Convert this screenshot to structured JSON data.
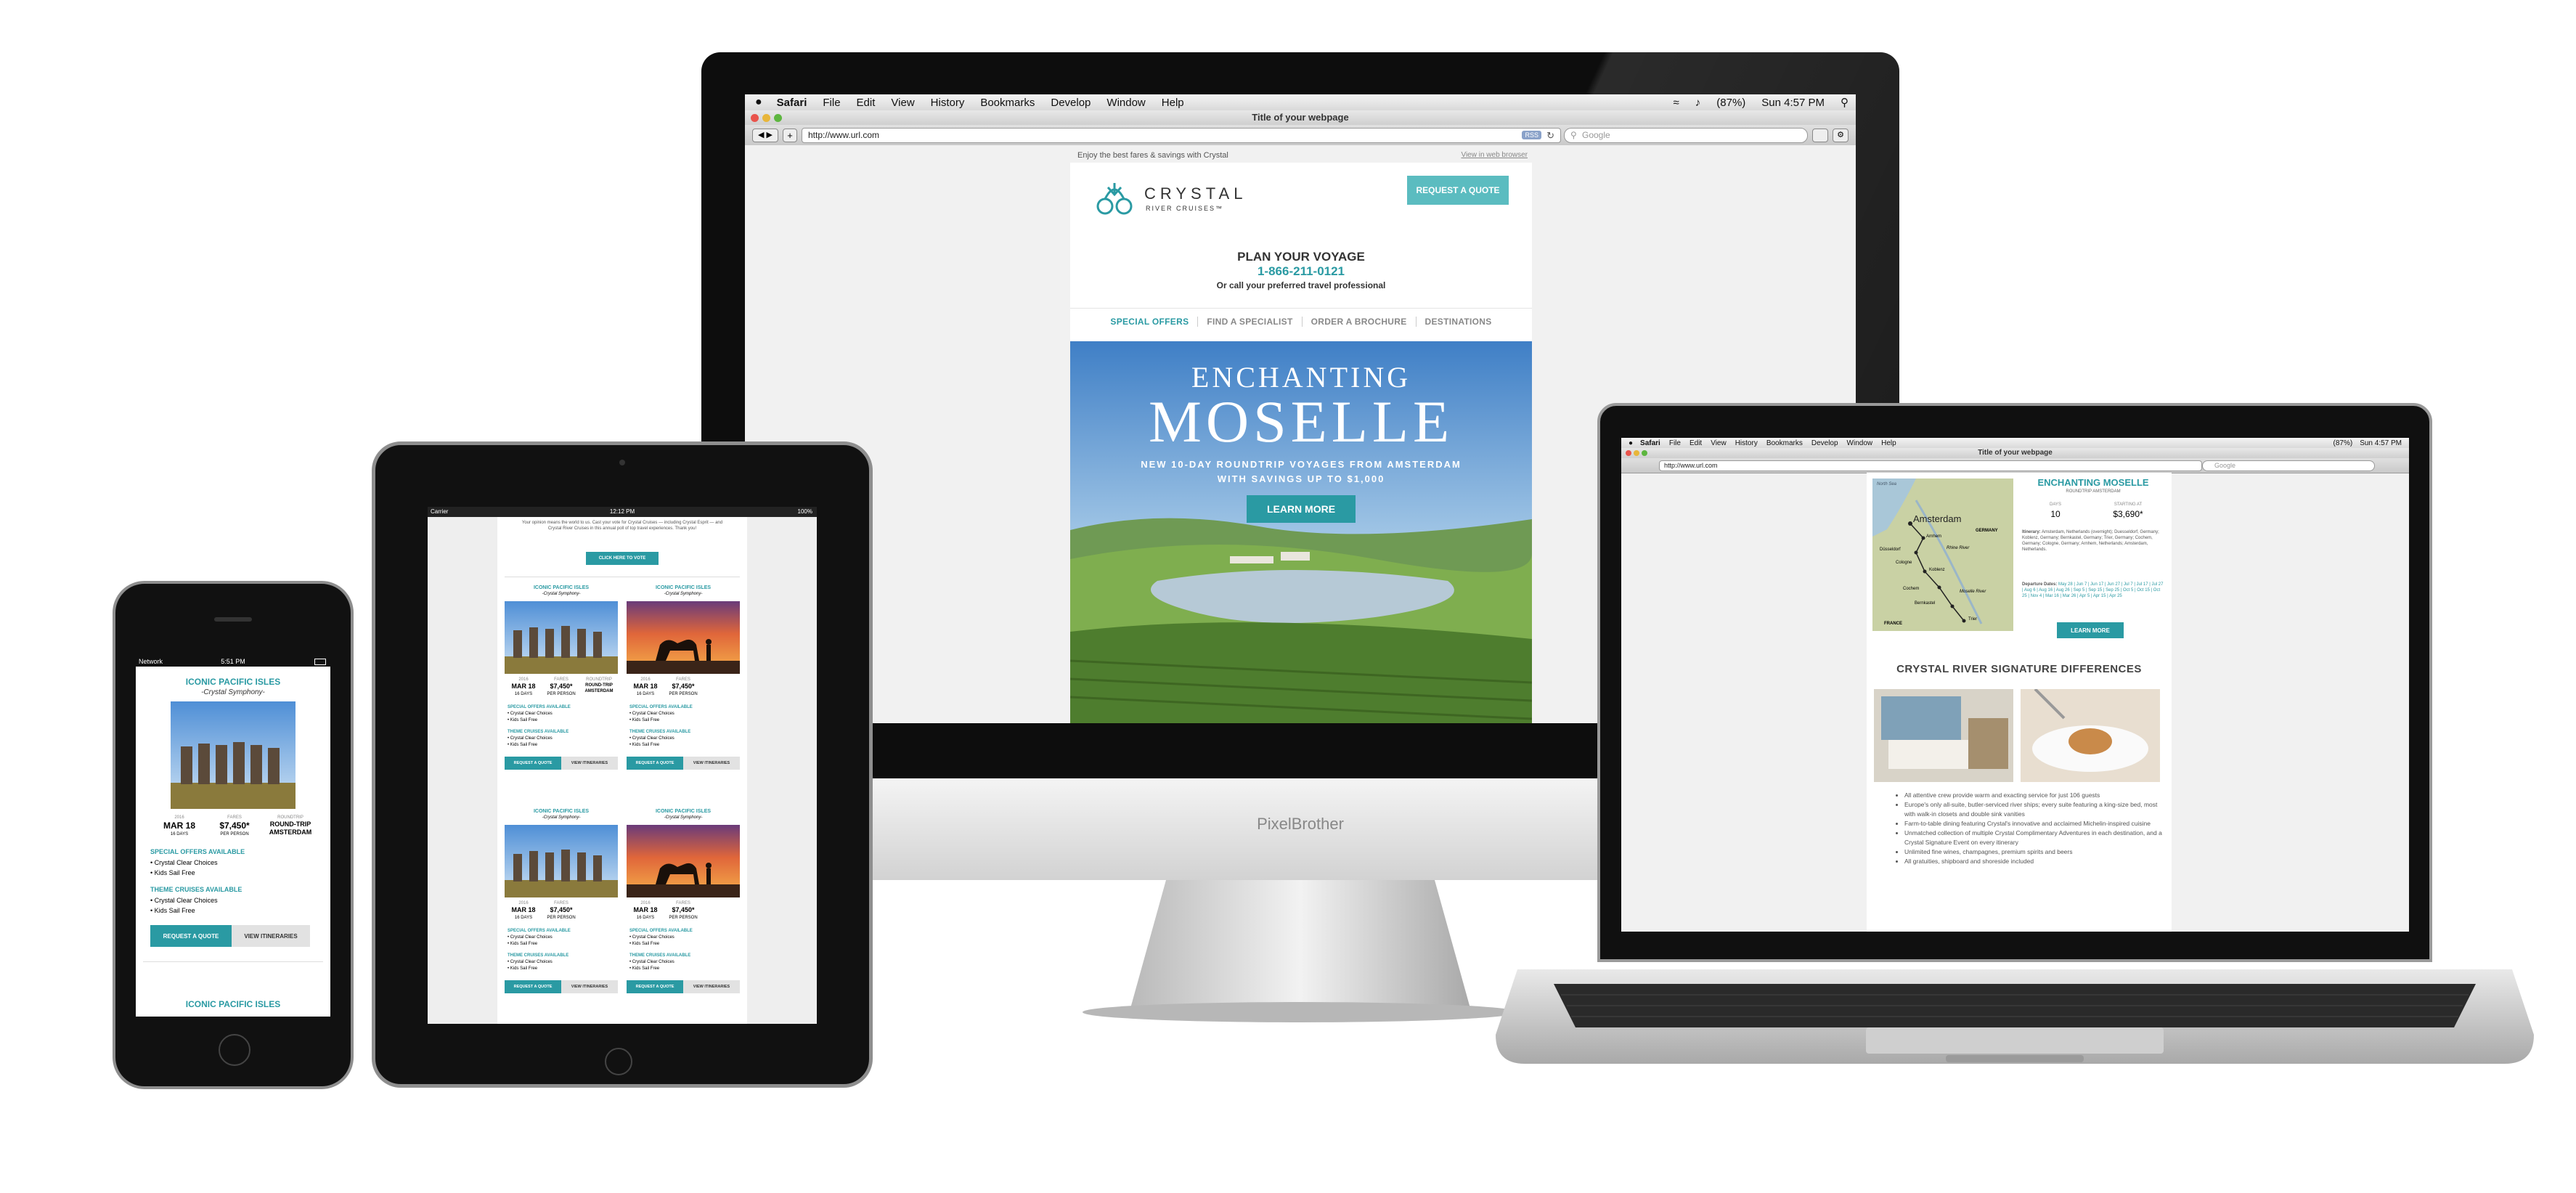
{
  "monitor": {
    "brand": "PixelBrother",
    "menubar": {
      "apple": "",
      "items": [
        "Safari",
        "File",
        "Edit",
        "View",
        "History",
        "Bookmarks",
        "Develop",
        "Window",
        "Help"
      ],
      "battery": "(87%)",
      "clock": "Sun 4:57 PM"
    },
    "window_title": "Title of your webpage",
    "url": "http://www.url.com",
    "search_placeholder": "Google",
    "rss": "RSS"
  },
  "email": {
    "preheader": "Enjoy the best fares & savings with Crystal",
    "view_in_browser": "View in web browser",
    "logo_name": "CRYSTAL",
    "logo_sub": "RIVER CRUISES™",
    "request_quote": "REQUEST A QUOTE",
    "plan_title": "PLAN YOUR VOYAGE",
    "phone": "1-866-211-0121",
    "plan_sub": "Or call your preferred travel professional",
    "nav": [
      "SPECIAL OFFERS",
      "FIND A SPECIALIST",
      "ORDER A BROCHURE",
      "DESTINATIONS"
    ],
    "hero_line1": "ENCHANTING",
    "hero_line2": "MOSELLE",
    "hero_tag1": "NEW 10-DAY ROUNDTRIP VOYAGES FROM AMSTERDAM",
    "hero_tag2": "WITH SAVINGS UP TO $1,000",
    "learn_more": "LEARN MORE"
  },
  "laptop": {
    "menubar": {
      "items": [
        "Safari",
        "File",
        "Edit",
        "View",
        "History",
        "Bookmarks",
        "Develop",
        "Window",
        "Help"
      ],
      "battery": "(87%)",
      "clock": "Sun 4:57 PM"
    },
    "window_title": "Title of your webpage",
    "url": "http://www.url.com",
    "search_placeholder": "Google",
    "map_labels": [
      "North Sea",
      "Amsterdam",
      "Arnhem",
      "Düsseldorf",
      "Cologne",
      "Koblenz",
      "Cochem",
      "Bernkastel",
      "Trier",
      "GERMANY",
      "FRANCE",
      "Rhine River",
      "Moselle River"
    ],
    "voyage_title": "ENCHANTING MOSELLE",
    "voyage_sub": "ROUNDTRIP AMSTERDAM",
    "days_label": "DAYS",
    "days_value": "10",
    "starting_label": "STARTING AT",
    "starting_value": "$3,690*",
    "itinerary_label": "Itinerary:",
    "itinerary_text": "Amsterdam, Netherlands (overnight); Duesseldorf, Germany; Koblenz, Germany; Bernkastel, Germany; Trier, Germany; Cochem, Germany; Cologne, Germany; Arnhem, Netherlands; Amsterdam, Netherlands.",
    "dates_label": "Departure Dates:",
    "dates_text": "May 28 | Jun 7 | Jun 17 | Jun 27 | Jul 7 | Jul 17 | Jul 27 | Aug 6 | Aug 16 | Aug 26 | Sep 5 | Sep 15 | Sep 25 | Oct 5 | Oct 15 | Oct 25 | Nov 4 | Mar 16 | Mar 26 | Apr 5 | Apr 15 | Apr 25",
    "learn_more": "LEARN MORE",
    "signature_title": "CRYSTAL RIVER SIGNATURE DIFFERENCES",
    "bullets": [
      "All attentive crew provide warm and exacting service for just 106 guests",
      "Europe's only all-suite, butler-serviced river ships; every suite featuring a king-size bed, most with walk-in closets and double sink vanities",
      "Farm-to-table dining featuring Crystal's innovative and acclaimed Michelin-inspired cuisine",
      "Unmatched collection of multiple Crystal Complimentary Adventures in each destination, and a Crystal Signature Event on every itinerary",
      "Unlimited fine wines, champagnes, premium spirits and beers",
      "All gratuities, shipboard and shoreside included"
    ]
  },
  "tablet": {
    "status": {
      "carrier": "Carrier",
      "time": "12:12 PM",
      "battery": "100%"
    },
    "intro": "Your opinion means the world to us. Cast your vote for Crystal Cruises — including Crystal Esprit — and Crystal River Cruises in this annual poll of top travel experiences. Thank you!",
    "vote_button": "CLICK HERE TO VOTE",
    "cards": [
      {
        "title": "ICONIC PACIFIC ISLES",
        "ship": "-Crystal Symphony-",
        "photo": "moai",
        "date_label": "2016",
        "date": "MAR 18",
        "days": "16 DAYS",
        "fare_label": "FARES",
        "fare": "$7,450*",
        "fare_sub": "PER PERSON",
        "trip_label": "ROUNDTRIP",
        "trip": "ROUND-TRIP AMSTERDAM",
        "offers_title": "SPECIAL OFFERS AVAILABLE",
        "offers": [
          "Crystal Clear Choices",
          "Kids Sail Free"
        ],
        "themes_title": "THEME CRUISES AVAILABLE",
        "themes": [
          "Crystal Clear Choices",
          "Kids Sail Free"
        ],
        "quote": "REQUEST A QUOTE",
        "itin": "VIEW ITINERARIES"
      },
      {
        "title": "ICONIC PACIFIC ISLES",
        "ship": "-Crystal Symphony-",
        "photo": "camel",
        "date_label": "2016",
        "date": "MAR 18",
        "days": "16 DAYS",
        "fare_label": "FARES",
        "fare": "$7,450*",
        "fare_sub": "PER PERSON",
        "trip_label": "",
        "trip": "",
        "offers_title": "SPECIAL OFFERS AVAILABLE",
        "offers": [
          "Crystal Clear Choices",
          "Kids Sail Free"
        ],
        "themes_title": "THEME CRUISES AVAILABLE",
        "themes": [
          "Crystal Clear Choices",
          "Kids Sail Free"
        ],
        "quote": "REQUEST A QUOTE",
        "itin": "VIEW ITINERARIES"
      },
      {
        "title": "ICONIC PACIFIC ISLES",
        "ship": "-Crystal Symphony-",
        "photo": "moai",
        "date_label": "2016",
        "date": "MAR 18",
        "days": "16 DAYS",
        "fare_label": "FARES",
        "fare": "$7,450*",
        "fare_sub": "PER PERSON",
        "trip_label": "",
        "trip": "",
        "offers_title": "SPECIAL OFFERS AVAILABLE",
        "offers": [
          "Crystal Clear Choices",
          "Kids Sail Free"
        ],
        "themes_title": "THEME CRUISES AVAILABLE",
        "themes": [
          "Crystal Clear Choices",
          "Kids Sail Free"
        ],
        "quote": "REQUEST A QUOTE",
        "itin": "VIEW ITINERARIES"
      },
      {
        "title": "ICONIC PACIFIC ISLES",
        "ship": "-Crystal Symphony-",
        "photo": "camel",
        "date_label": "2016",
        "date": "MAR 18",
        "days": "16 DAYS",
        "fare_label": "FARES",
        "fare": "$7,450*",
        "fare_sub": "PER PERSON",
        "trip_label": "",
        "trip": "",
        "offers_title": "SPECIAL OFFERS AVAILABLE",
        "offers": [
          "Crystal Clear Choices",
          "Kids Sail Free"
        ],
        "themes_title": "THEME CRUISES AVAILABLE",
        "themes": [
          "Crystal Clear Choices",
          "Kids Sail Free"
        ],
        "quote": "REQUEST A QUOTE",
        "itin": "VIEW ITINERARIES"
      }
    ]
  },
  "phone": {
    "status": {
      "carrier": "Network",
      "time": "5:51 PM"
    },
    "title": "ICONIC PACIFIC ISLES",
    "ship": "-Crystal Symphony-",
    "date_label": "2016",
    "date": "MAR 18",
    "days": "16 DAYS",
    "fare_label": "FARES",
    "fare": "$7,450*",
    "fare_sub": "PER PERSON",
    "trip_label": "ROUNDTRIP",
    "trip": "ROUND-TRIP AMSTERDAM",
    "offers_title": "SPECIAL OFFERS AVAILABLE",
    "offers": [
      "Crystal Clear Choices",
      "Kids Sail Free"
    ],
    "themes_title": "THEME CRUISES AVAILABLE",
    "themes": [
      "Crystal Clear Choices",
      "Kids Sail Free"
    ],
    "quote": "REQUEST A QUOTE",
    "itin": "VIEW ITINERARIES",
    "next_title": "ICONIC PACIFIC ISLES"
  }
}
